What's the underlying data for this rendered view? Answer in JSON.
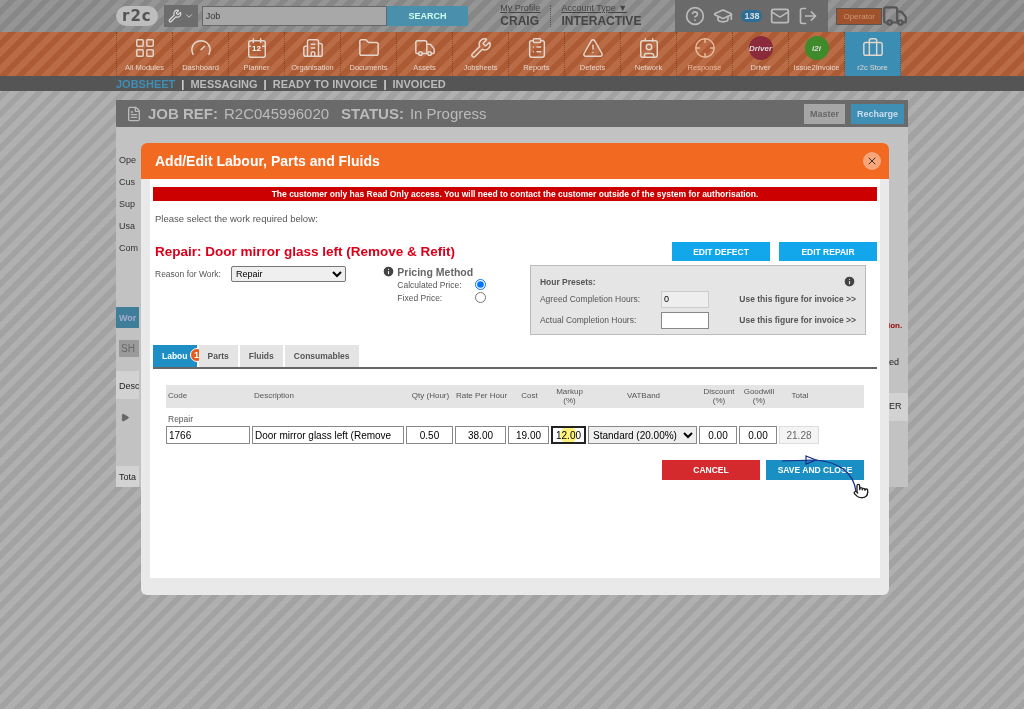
{
  "header": {
    "logo": "r2c",
    "search": {
      "placeholder": "Job",
      "button": "SEARCH"
    },
    "profile": {
      "link": "My Profile",
      "name": "CRAIG"
    },
    "account": {
      "link": "Account Type ▼",
      "value": "INTERACTIVE"
    },
    "notification_count": "138",
    "operator_label": "Operator"
  },
  "modules": [
    {
      "label": "All Modules",
      "kind": "icon",
      "selected": false,
      "disabled": false
    },
    {
      "label": "Dashboard",
      "kind": "icon",
      "selected": false,
      "disabled": false
    },
    {
      "label": "Planner",
      "kind": "icon",
      "icon_text": "12",
      "selected": false,
      "disabled": false
    },
    {
      "label": "Organisation",
      "kind": "icon",
      "selected": false,
      "disabled": false
    },
    {
      "label": "Documents",
      "kind": "icon",
      "selected": false,
      "disabled": false
    },
    {
      "label": "Assets",
      "kind": "icon",
      "selected": false,
      "disabled": false
    },
    {
      "label": "Jobsheets",
      "kind": "icon",
      "selected": false,
      "disabled": false
    },
    {
      "label": "Reports",
      "kind": "icon",
      "selected": false,
      "disabled": false
    },
    {
      "label": "Defects",
      "kind": "icon",
      "selected": false,
      "disabled": false
    },
    {
      "label": "Network",
      "kind": "icon",
      "selected": false,
      "disabled": false
    },
    {
      "label": "Response",
      "kind": "icon",
      "selected": false,
      "disabled": true
    },
    {
      "label": "Driver",
      "kind": "badge",
      "icon_text": "Driver",
      "color": "#8a2a3a",
      "selected": false,
      "disabled": false
    },
    {
      "label": "Issue2Invoice",
      "kind": "badge",
      "icon_text": "i2i",
      "color": "#3f8a2a",
      "selected": false,
      "disabled": false
    },
    {
      "label": "r2c Store",
      "kind": "icon",
      "selected": true,
      "disabled": false
    }
  ],
  "subnav": [
    {
      "label": "JOBSHEET",
      "selected": true
    },
    {
      "separator": "|",
      "label": "MESSAGING",
      "selected": false
    },
    {
      "separator": "|",
      "label": "READY TO INVOICE",
      "selected": false
    },
    {
      "separator": "|",
      "label": "INVOICED",
      "selected": false
    }
  ],
  "job": {
    "ref_label": "JOB REF:",
    "ref": "R2C045996020",
    "status_label": "STATUS:",
    "status": "In Progress",
    "buttons": [
      {
        "label": "Master",
        "selected": false
      },
      {
        "label": "Recharge",
        "selected": true
      }
    ]
  },
  "background": {
    "labels": [
      "Ope",
      "Cus",
      "Sup",
      "Usa",
      "Com"
    ],
    "work_tab": "Wor",
    "show_button": "SH",
    "table_header": "Desc",
    "total": "Tota",
    "right_warning": "ion.",
    "right_text": "ed",
    "right_header": "ER"
  },
  "modal": {
    "title": "Add/Edit Labour, Parts and Fluids",
    "banner": "The customer only has Read Only access. You will need to contact the customer outside of the system for authorisation.",
    "prompt": "Please select the work required below:",
    "heading": "Repair: Door mirror glass left (Remove & Refit)",
    "actions": [
      "EDIT DEFECT",
      "EDIT REPAIR"
    ],
    "reason": {
      "label": "Reason for Work:",
      "value": "Repair"
    },
    "pricing": {
      "title": "Pricing Method",
      "options": [
        {
          "label": "Calculated Price:",
          "selected": true
        },
        {
          "label": "Fixed Price:",
          "selected": false
        }
      ]
    },
    "hour_presets": {
      "title": "Hour Presets:",
      "rows": [
        {
          "label": "Agreed Completion Hours:",
          "value": "0",
          "readonly": true,
          "link": "Use this figure for invoice >>"
        },
        {
          "label": "Actual Completion Hours:",
          "value": "",
          "readonly": false,
          "link": "Use this figure for invoice >>"
        }
      ]
    },
    "tabs": [
      {
        "label": "Labou",
        "badge": "1",
        "selected": true
      },
      {
        "label": "Parts",
        "selected": false
      },
      {
        "label": "Fluids",
        "selected": false
      },
      {
        "label": "Consumables",
        "selected": false
      }
    ],
    "table": {
      "columns": [
        "Code",
        "Description",
        "Qty (Hour)",
        "Rate Per Hour",
        "Cost",
        "Markup (%)",
        "VATBand",
        "Discount (%)",
        "Goodwill (%)",
        "Total"
      ],
      "group": "Repair",
      "row": [
        {
          "kind": "text",
          "value": "1766",
          "highlighted": false
        },
        {
          "kind": "text",
          "value": "Door mirror glass left (Remove",
          "highlighted": false
        },
        {
          "kind": "number",
          "value": "0.50",
          "highlighted": false
        },
        {
          "kind": "number",
          "value": "38.00",
          "highlighted": false
        },
        {
          "kind": "number",
          "value": "19.00",
          "highlighted": false
        },
        {
          "kind": "number",
          "value": "12.00",
          "highlighted": true
        },
        {
          "kind": "select",
          "value": "Standard (20.00%)",
          "highlighted": false
        },
        {
          "kind": "number",
          "value": "0.00",
          "highlighted": false
        },
        {
          "kind": "number",
          "value": "0.00",
          "highlighted": false
        },
        {
          "kind": "readonly",
          "value": "21.28",
          "highlighted": false
        }
      ]
    },
    "buttons": [
      {
        "label": "CANCEL",
        "kind": "cancel"
      },
      {
        "label": "SAVE AND CLOSE",
        "kind": "save"
      }
    ]
  }
}
